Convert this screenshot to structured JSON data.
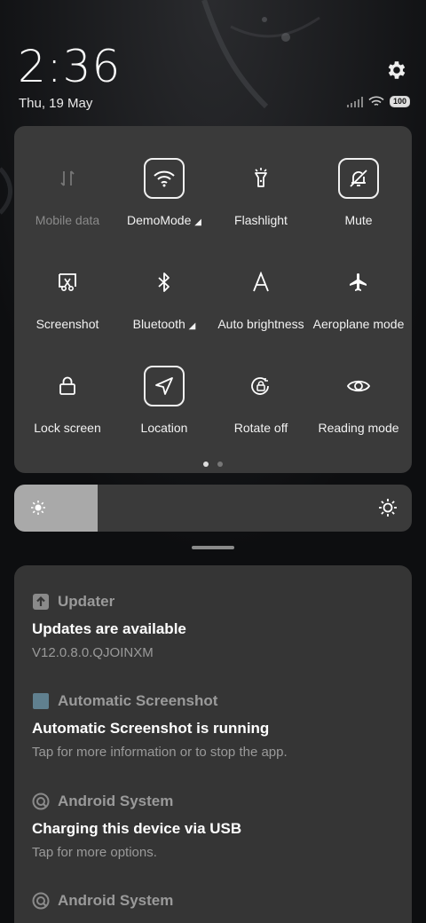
{
  "status": {
    "time": "2:36",
    "date": "Thu, 19 May",
    "battery": "100"
  },
  "quick_settings": {
    "tiles": [
      {
        "label": "Mobile data",
        "icon": "mobile-data-icon",
        "state": "disabled"
      },
      {
        "label": "DemoMode",
        "icon": "wifi-icon",
        "state": "on"
      },
      {
        "label": "Flashlight",
        "icon": "flashlight-icon",
        "state": "off"
      },
      {
        "label": "Mute",
        "icon": "bell-off-icon",
        "state": "on"
      },
      {
        "label": "Screenshot",
        "icon": "screenshot-icon",
        "state": "off"
      },
      {
        "label": "Bluetooth",
        "icon": "bluetooth-icon",
        "state": "off"
      },
      {
        "label": "Auto brightness",
        "icon": "auto-brightness-icon",
        "state": "off"
      },
      {
        "label": "Aeroplane mode",
        "icon": "airplane-icon",
        "state": "off"
      },
      {
        "label": "Lock screen",
        "icon": "lock-icon",
        "state": "off"
      },
      {
        "label": "Location",
        "icon": "location-icon",
        "state": "on"
      },
      {
        "label": "Rotate off",
        "icon": "rotate-lock-icon",
        "state": "off"
      },
      {
        "label": "Reading mode",
        "icon": "eye-icon",
        "state": "off"
      }
    ],
    "pages": 2,
    "current_page": 1
  },
  "brightness": {
    "level": 0.21
  },
  "notifications": [
    {
      "app": "Updater",
      "icon": "update-arrow-icon",
      "title": "Updates are available",
      "body": "V12.0.8.0.QJOINXM"
    },
    {
      "app": "Automatic Screenshot",
      "icon": "screenshot-app-icon",
      "title": "Automatic Screenshot is running",
      "body": "Tap for more information or to stop the app."
    },
    {
      "app": "Android System",
      "icon": "android-system-icon",
      "title": "Charging this device via USB",
      "body": "Tap for more options."
    },
    {
      "app": "Android System",
      "icon": "android-system-icon",
      "title": "",
      "body": ""
    }
  ],
  "colors": {
    "panel": "#3a3a3a",
    "notification_panel": "#353535",
    "brightness_fill": "#a9a9a9"
  }
}
